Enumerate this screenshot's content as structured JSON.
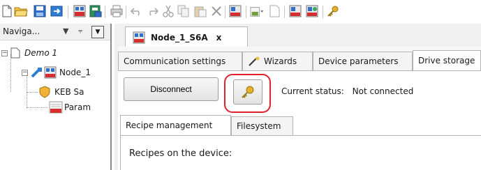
{
  "toolbar": {
    "icons": [
      "new-file-icon",
      "open-folder-icon",
      "save-icon",
      "import-icon",
      "keb-device-icon",
      "db-icon",
      "print-icon",
      "undo-icon",
      "redo-icon",
      "cut-icon",
      "copy-icon",
      "paste-icon",
      "delete-icon",
      "keb-connect-icon",
      "insert-node-icon",
      "export-icon",
      "keb-online-icon",
      "keb-scan-icon",
      "key-icon"
    ]
  },
  "navigator": {
    "title": "Naviga...",
    "pin_glyph": "⫧",
    "close_glyph": "✕",
    "tree": {
      "root": "Demo 1",
      "node": "Node_1",
      "children": [
        "KEB Sa",
        "Param"
      ]
    }
  },
  "document_tab": {
    "label": "Node_1_S6A",
    "close": "x"
  },
  "tabs": [
    "Communication settings",
    "Wizards",
    "Device parameters",
    "Drive storage"
  ],
  "actions": {
    "disconnect_label": "Disconnect"
  },
  "status": {
    "label": "Current status:",
    "value": "Not connected"
  },
  "inner_tabs": [
    "Recipe management",
    "Filesystem"
  ],
  "recipes_heading": "Recipes on the device:",
  "colors": {
    "highlight": "#e0212b",
    "accent_blue": "#2f6fc9",
    "keb_red": "#d62e2e",
    "key_gold": "#e5b02b"
  }
}
